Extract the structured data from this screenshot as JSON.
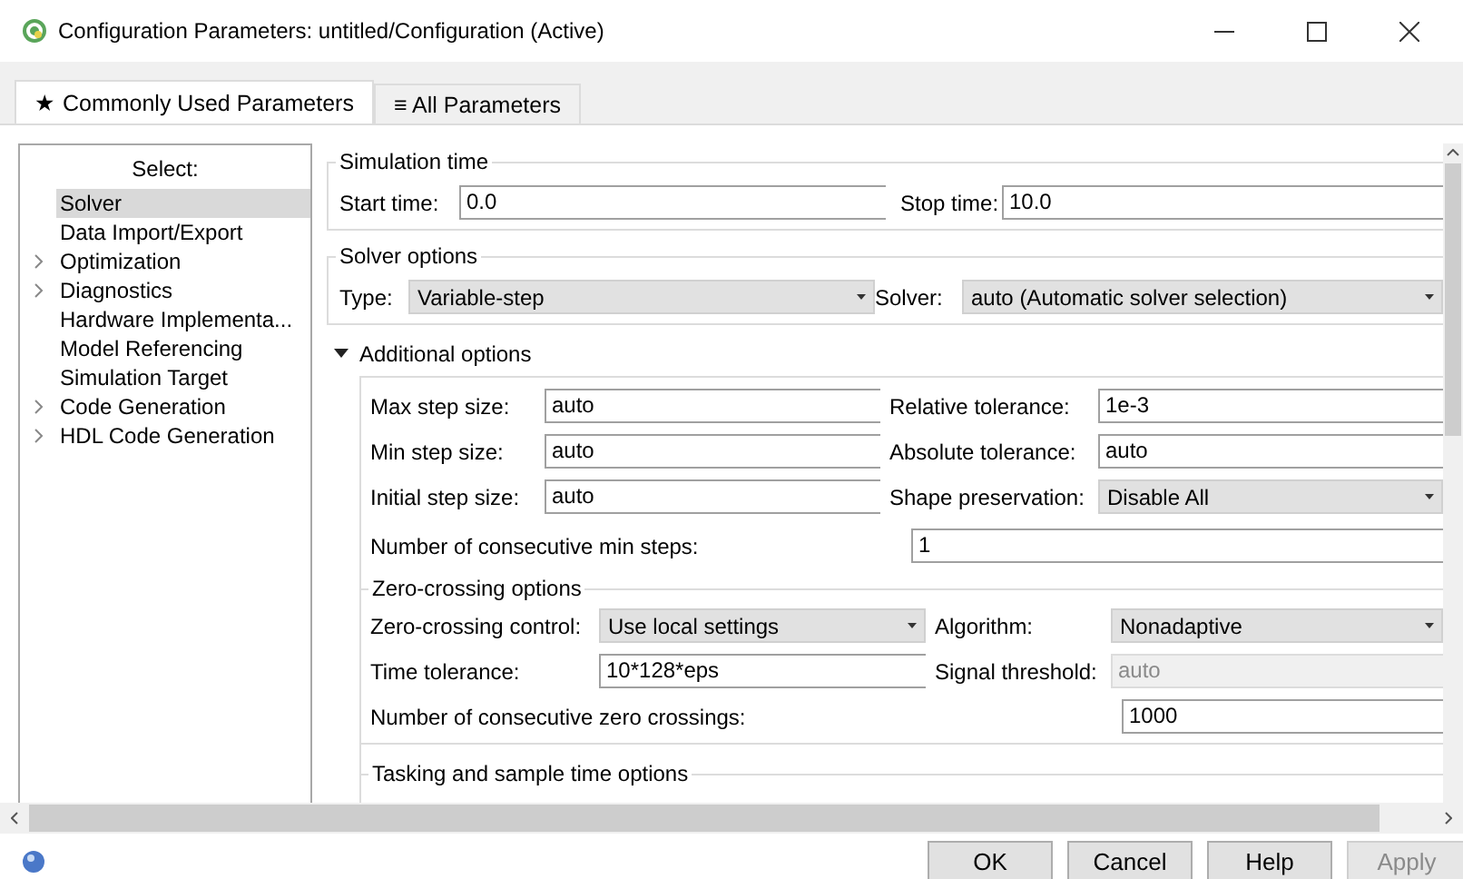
{
  "window": {
    "title": "Configuration Parameters: untitled/Configuration (Active)"
  },
  "tabs": [
    {
      "icon": "★",
      "label": "Commonly Used Parameters",
      "selected": true
    },
    {
      "icon": "≡",
      "label": "All Parameters",
      "selected": false
    }
  ],
  "sidebar": {
    "heading": "Select:",
    "items": [
      {
        "label": "Solver",
        "selected": true,
        "expandable": false
      },
      {
        "label": "Data Import/Export",
        "selected": false,
        "expandable": false
      },
      {
        "label": "Optimization",
        "selected": false,
        "expandable": true
      },
      {
        "label": "Diagnostics",
        "selected": false,
        "expandable": true
      },
      {
        "label": "Hardware Implementa...",
        "selected": false,
        "expandable": false
      },
      {
        "label": "Model Referencing",
        "selected": false,
        "expandable": false
      },
      {
        "label": "Simulation Target",
        "selected": false,
        "expandable": false
      },
      {
        "label": "Code Generation",
        "selected": false,
        "expandable": true
      },
      {
        "label": "HDL Code Generation",
        "selected": false,
        "expandable": true
      }
    ]
  },
  "simulation_time": {
    "title": "Simulation time",
    "fields": [
      {
        "label": "Start time:",
        "value": "0.0",
        "kind": "text"
      },
      {
        "label": "Stop time:",
        "value": "10.0",
        "kind": "text"
      }
    ]
  },
  "solver_options": {
    "title": "Solver options",
    "fields": [
      {
        "label": "Type:",
        "value": "Variable-step",
        "kind": "dropdown"
      },
      {
        "label": "Solver:",
        "value": "auto (Automatic solver selection)",
        "kind": "dropdown"
      }
    ]
  },
  "additional_options": {
    "label": "Additional options",
    "expanded": true,
    "fields": [
      {
        "label": "Max step size:",
        "value": "auto",
        "kind": "text"
      },
      {
        "label": "Relative tolerance:",
        "value": "1e-3",
        "kind": "text"
      },
      {
        "label": "Min step size:",
        "value": "auto",
        "kind": "text"
      },
      {
        "label": "Absolute tolerance:",
        "value": "auto",
        "kind": "text"
      },
      {
        "label": "Initial step size:",
        "value": "auto",
        "kind": "text"
      },
      {
        "label": "Shape preservation:",
        "value": "Disable All",
        "kind": "dropdown"
      }
    ],
    "min_steps": {
      "label": "Number of consecutive min steps:",
      "value": "1",
      "kind": "text"
    }
  },
  "zero_crossing": {
    "title": "Zero-crossing options",
    "fields": [
      {
        "label": "Zero-crossing control:",
        "value": "Use local settings",
        "kind": "dropdown",
        "disabled": false
      },
      {
        "label": "Algorithm:",
        "value": "Nonadaptive",
        "kind": "dropdown",
        "disabled": false
      },
      {
        "label": "Time tolerance:",
        "value": "10*128*eps",
        "kind": "text",
        "disabled": false
      },
      {
        "label": "Signal threshold:",
        "value": "auto",
        "kind": "text",
        "disabled": true
      }
    ],
    "consecutive": {
      "label": "Number of consecutive zero crossings:",
      "value": "1000",
      "kind": "text"
    }
  },
  "tasking": {
    "title": "Tasking and sample time options"
  },
  "buttons": [
    {
      "label": "OK",
      "disabled": false
    },
    {
      "label": "Cancel",
      "disabled": false
    },
    {
      "label": "Help",
      "disabled": false
    },
    {
      "label": "Apply",
      "disabled": true
    }
  ]
}
